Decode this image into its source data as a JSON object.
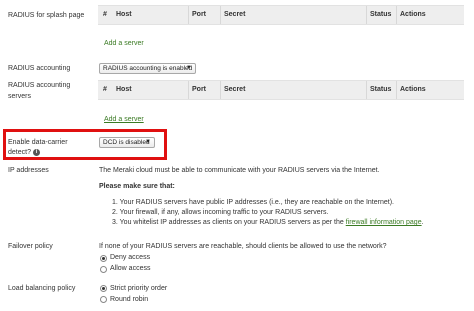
{
  "splash": {
    "label": "RADIUS for splash page",
    "headers": [
      "#",
      "Host",
      "Port",
      "Secret",
      "Status",
      "Actions"
    ],
    "add_link": "Add a server"
  },
  "accounting": {
    "label": "RADIUS accounting",
    "select_value": "RADIUS accounting is enabled",
    "arrow": "▼"
  },
  "accounting_servers": {
    "label_line1": "RADIUS accounting",
    "label_line2": "servers",
    "headers": [
      "#",
      "Host",
      "Port",
      "Secret",
      "Status",
      "Actions"
    ],
    "add_link": "Add a server"
  },
  "dcd": {
    "label_line1": "Enable data-carrier",
    "label_line2": "detect?",
    "info_icon": "i",
    "select_value": "DCD is disabled",
    "arrow": "▼",
    "highlight_color": "#e01010"
  },
  "ip_addresses": {
    "label": "IP addresses",
    "intro": "The Meraki cloud must be able to communicate with your RADIUS servers via the Internet.",
    "make_sure": "Please make sure that:",
    "item1": "1. Your RADIUS servers have public IP addresses (i.e., they are reachable on the Internet).",
    "item2": "2. Your firewall, if any, allows incoming traffic to your RADIUS servers.",
    "item3_prefix": "3. You whitelist IP addresses as clients on your RADIUS servers as per the ",
    "item3_link": "firewall information page",
    "item3_suffix": "."
  },
  "failover": {
    "label": "Failover policy",
    "question": "If none of your RADIUS servers are reachable, should clients be allowed to use the network?",
    "options": [
      "Deny access",
      "Allow access"
    ],
    "selected": "Deny access"
  },
  "load_balancing": {
    "label": "Load balancing policy",
    "options": [
      "Strict priority order",
      "Round robin"
    ],
    "selected": "Strict priority order"
  },
  "colors": {
    "link": "#3a7a23",
    "header_bg": "#eeeeee"
  }
}
